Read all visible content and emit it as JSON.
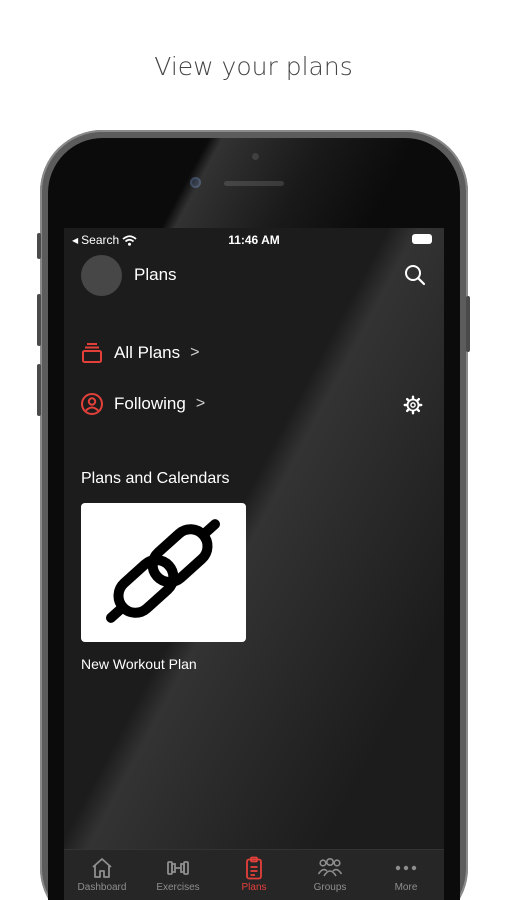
{
  "caption": "View your plans",
  "status_bar": {
    "back_label": "Search",
    "time": "11:46 AM"
  },
  "header": {
    "title": "Plans"
  },
  "nav_rows": [
    {
      "label": "All Plans",
      "chevron": ">"
    },
    {
      "label": "Following",
      "chevron": ">"
    }
  ],
  "section": {
    "title": "Plans and Calendars",
    "plans": [
      {
        "title": "New Workout Plan",
        "icon": "link-icon"
      }
    ]
  },
  "tab_bar": {
    "active": "Plans",
    "tabs": [
      {
        "label": "Dashboard",
        "icon": "home-icon"
      },
      {
        "label": "Exercises",
        "icon": "dumbbell-icon"
      },
      {
        "label": "Plans",
        "icon": "clipboard-icon"
      },
      {
        "label": "Groups",
        "icon": "people-icon"
      },
      {
        "label": "More",
        "icon": "more-icon"
      }
    ]
  },
  "colors": {
    "accent": "#e4403a",
    "background": "#1c1c1d",
    "tab_bar": "#262627",
    "inactive": "#8e8e8e"
  }
}
